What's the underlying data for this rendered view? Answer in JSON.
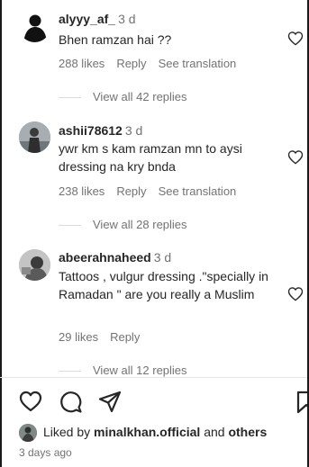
{
  "comments": [
    {
      "username": "alyyy_af_",
      "time": "3 d",
      "text": "Bhen ramzan hai ??",
      "likes": "288 likes",
      "reply": "Reply",
      "translation": "See translation",
      "view_replies": "View all 42 replies"
    },
    {
      "username": "ashii78612",
      "time": "3 d",
      "text": "ywr km s kam ramzan mn to aysi dressing na kry bnda",
      "likes": "238 likes",
      "reply": "Reply",
      "translation": "See translation",
      "view_replies": "View all 28 replies"
    },
    {
      "username": "abeerahnaheed",
      "time": "3 d",
      "text": "Tattoos , vulgur dressing .\"specially in Ramadan \" are you really a Muslim",
      "likes": "29 likes",
      "reply": "Reply",
      "view_replies": "View all 12 replies"
    }
  ],
  "footer": {
    "liked_prefix": "Liked by",
    "liked_user": "minalkhan.official",
    "liked_and": "and",
    "liked_others": "others",
    "time_ago": "3 days ago"
  },
  "icons": {
    "like": "heart-icon",
    "comment": "comment-bubble-icon",
    "share": "paper-plane-icon",
    "save": "bookmark-icon"
  },
  "colors": {
    "text": "#262626",
    "secondary": "#737373",
    "divider": "#dbdbdb"
  }
}
